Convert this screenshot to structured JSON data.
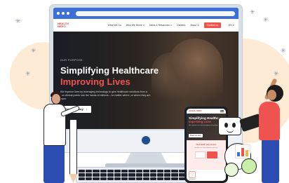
{
  "site": {
    "logo_line1": "HEALTH",
    "logo_line2": "HERO",
    "nav": [
      "What We Do",
      "Who We Serve ∨",
      "News & Resources ∨",
      "Careers",
      "About ∨"
    ],
    "cta": "Contact us",
    "lang": "EN ∨"
  },
  "hero": {
    "eyebrow": "OUR PURPOSE",
    "title_line1": "Simplifying Healthcare",
    "title_line2": "Improving Lives",
    "body": "We improve lives by leveraging technology to give healthcare solutions from a few clinical points into the hands of millions – no matter where, or where they are each.",
    "button": "Read our story",
    "button_arrow": "›"
  },
  "phone": {
    "logo": "HEALTH HERO",
    "title": "Simplifying Healthcare",
    "subtitle": "Improving Lives",
    "body": "We improve lives by leveraging technology.",
    "button": "Read our story",
    "section_title": "Our bold new vision",
    "section_text": "Healthcare from wherever you are",
    "foot_label": "Integrated"
  },
  "colors": {
    "accent": "#ef5350",
    "brand_blue": "#3d6fd8",
    "peach": "#fdebd6",
    "screen_dark": "#20242b"
  }
}
